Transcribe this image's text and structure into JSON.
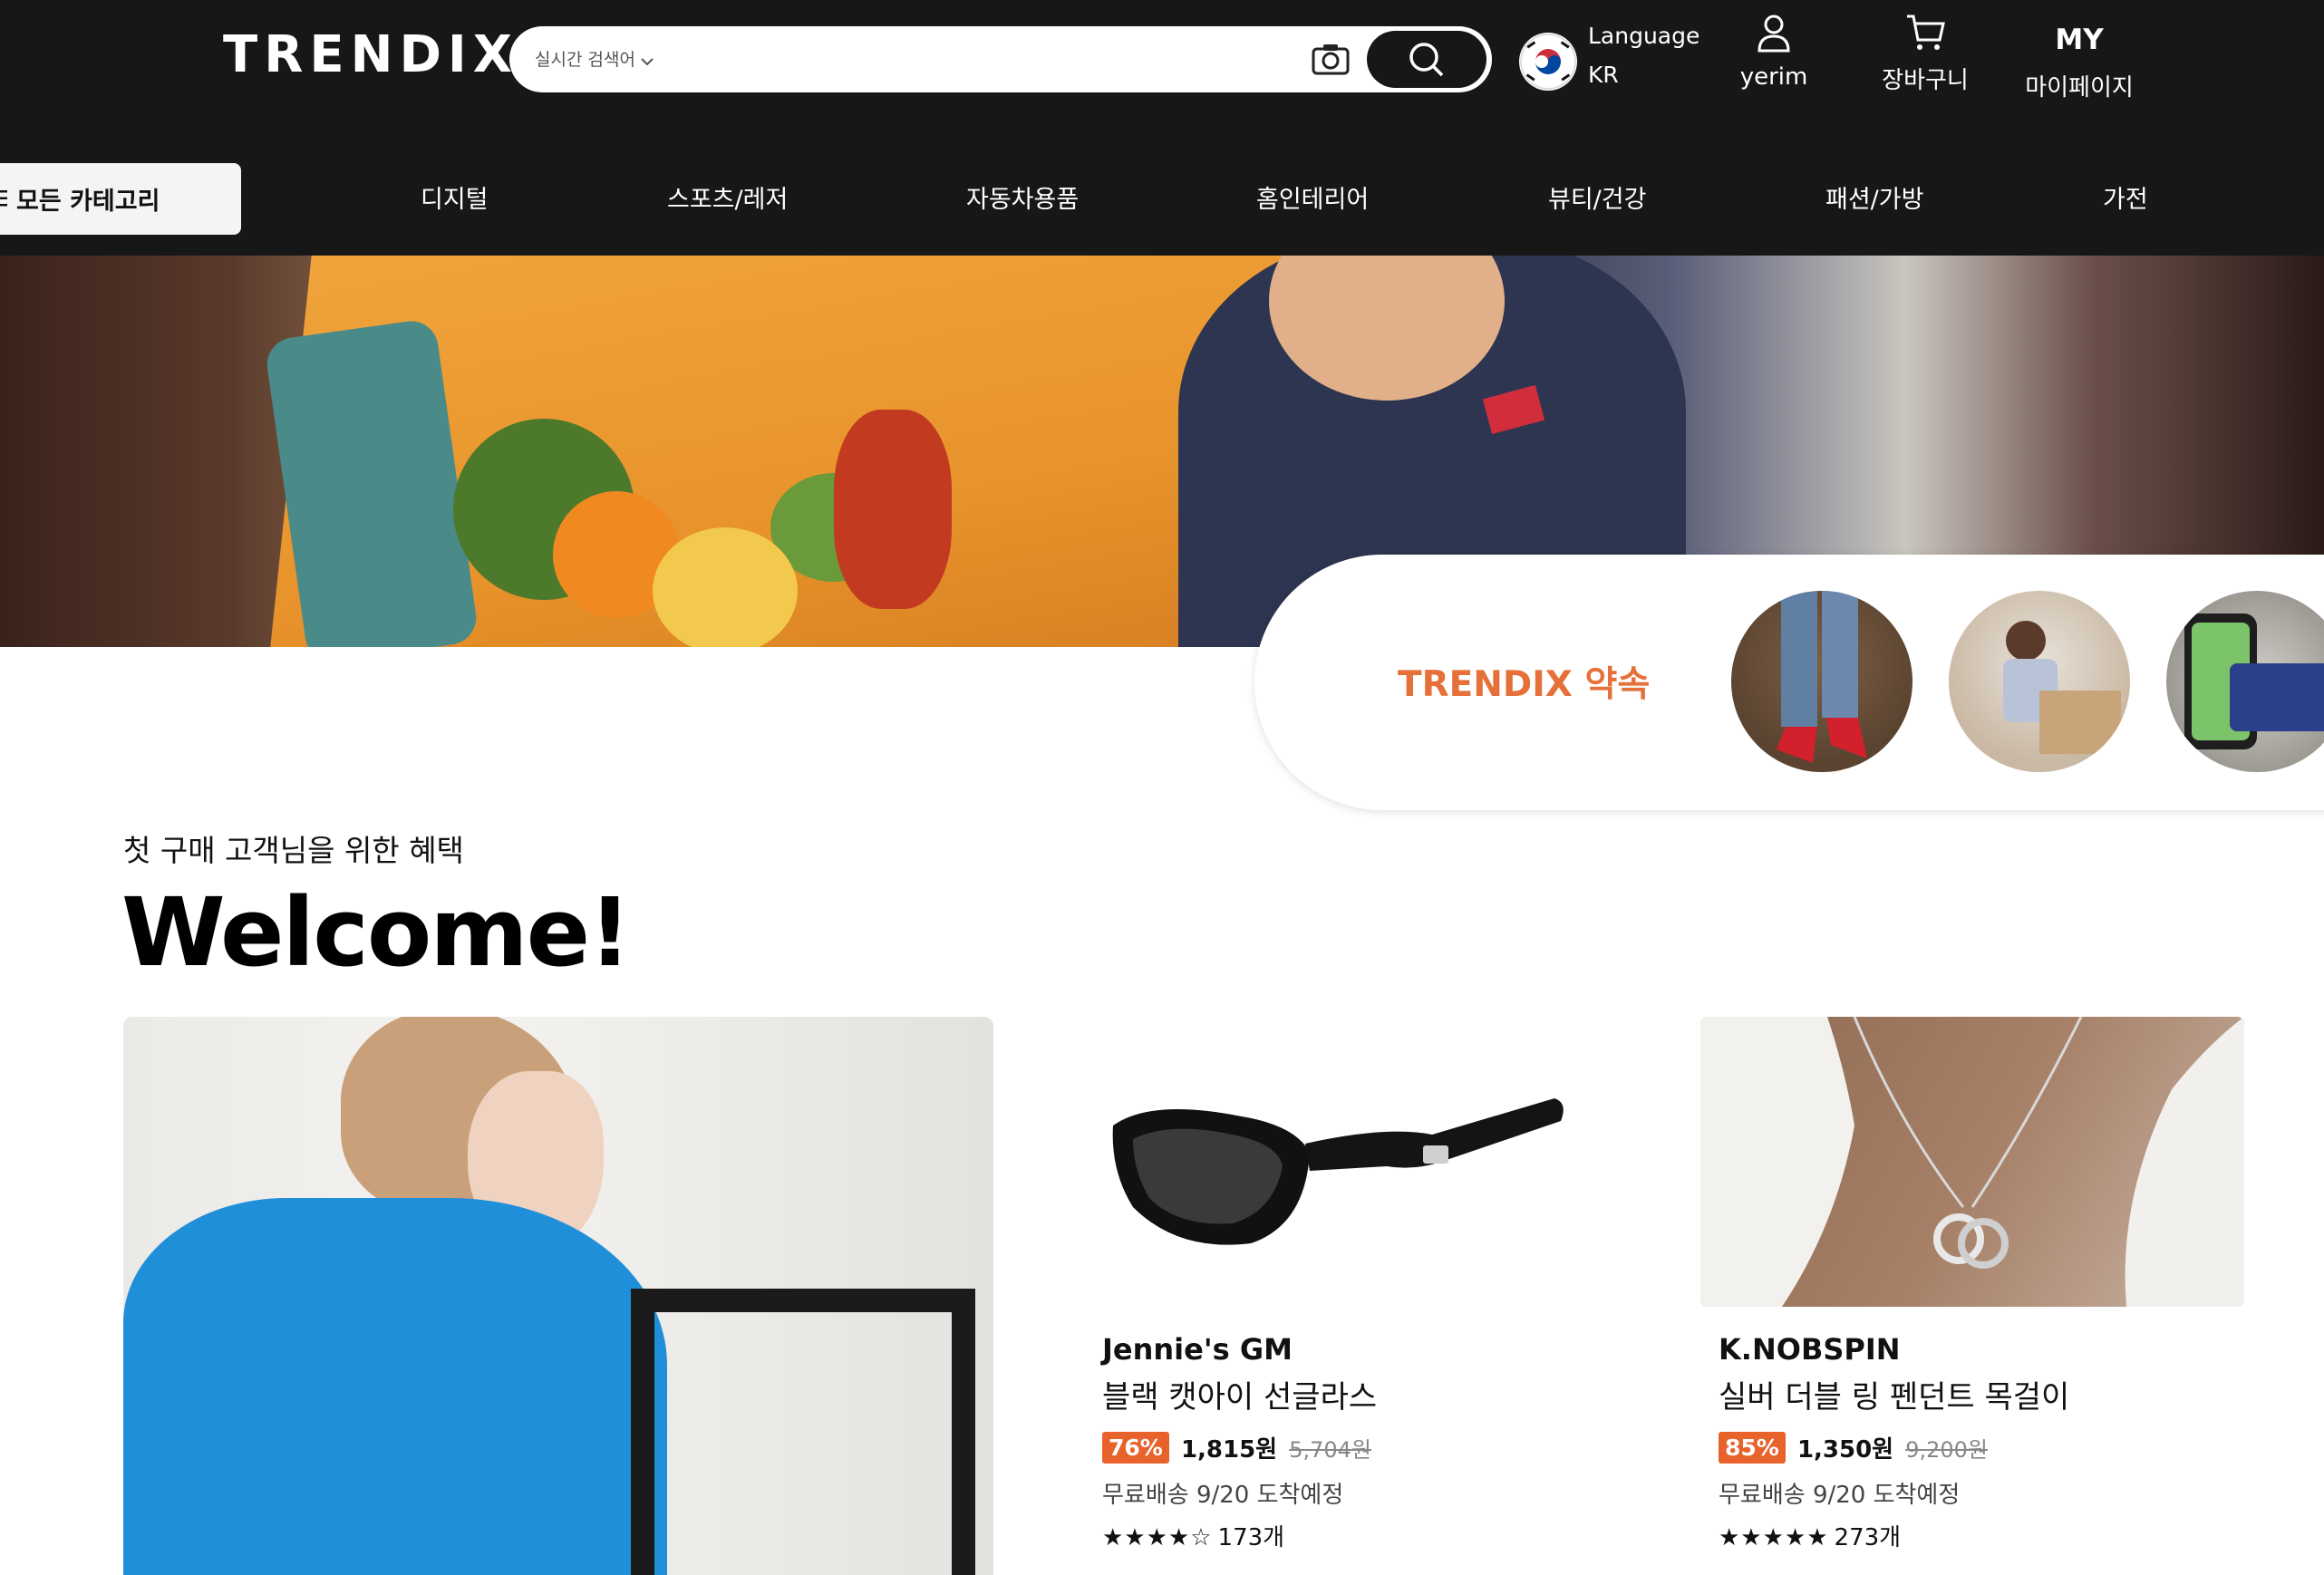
{
  "header": {
    "logo": "TRENDIX",
    "search": {
      "trending_label": "실시간 검색어",
      "placeholder": ""
    },
    "language": {
      "label": "Language",
      "value": "KR"
    },
    "user": {
      "name": "yerim"
    },
    "cart": {
      "label": "장바구니"
    },
    "mypage": {
      "short": "MY",
      "label": "마이페이지"
    }
  },
  "nav": {
    "all_categories": "모든 카테고리",
    "items": [
      "디지털",
      "스포츠/레저",
      "자동차용품",
      "홈인테리어",
      "뷰티/건강",
      "패션/가방",
      "가전"
    ]
  },
  "promise": {
    "title": "TRENDIX 약속"
  },
  "welcome": {
    "subtitle": "첫 구매 고객님을 위한 혜택",
    "title": "Welcome!"
  },
  "products": [
    {
      "brand": "Jennie's GM",
      "name": "블랙 캣아이 선글라스",
      "discount": "76%",
      "price": "1,815원",
      "original_price": "5,704원",
      "shipping": "무료배송 9/20 도착예정",
      "stars": "★★★★☆",
      "rating": 4,
      "reviews": "173개"
    },
    {
      "brand": "K.NOBSPIN",
      "name": "실버 더블 링 펜던트 목걸이",
      "discount": "85%",
      "price": "1,350원",
      "original_price": "9,200원",
      "shipping": "무료배송 9/20 도착예정",
      "stars": "★★★★★",
      "rating": 5,
      "reviews": "273개"
    }
  ],
  "colors": {
    "header_bg": "#171717",
    "accent_orange": "#e5703a",
    "discount_badge": "#e8622c"
  },
  "icons": [
    "camera-icon",
    "search-icon",
    "korea-flag-icon",
    "user-icon",
    "cart-icon",
    "menu-icon"
  ]
}
